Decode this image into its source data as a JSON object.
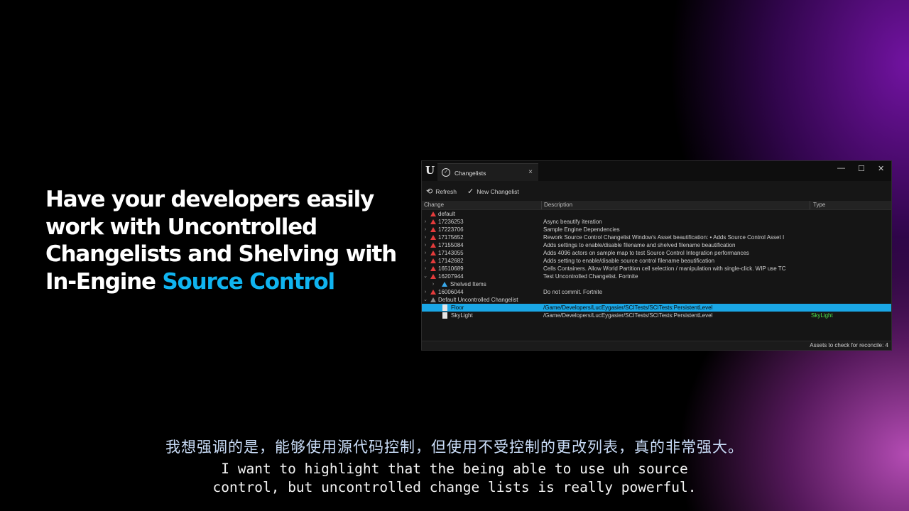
{
  "headline": {
    "text_before": "Have your developers easily work with Uncontrolled Changelists and Shelving with In-Engine ",
    "accent": "Source Control"
  },
  "window": {
    "logo": "U",
    "tab_label": "Changelists",
    "tab_close": "×",
    "controls": {
      "minimize": "—",
      "maximize": "☐",
      "close": "✕"
    },
    "toolbar": {
      "refresh_label": "Refresh",
      "new_changelist_label": "New Changelist"
    },
    "columns": {
      "change": "Change",
      "description": "Description",
      "type": "Type"
    },
    "rows": [
      {
        "change": "default",
        "description": "",
        "type": ""
      },
      {
        "change": "17236253",
        "description": "Async beautify iteration",
        "type": ""
      },
      {
        "change": "17223706",
        "description": "Sample Engine Dependencies",
        "type": ""
      },
      {
        "change": "17175652",
        "description": "Rework Source Control Changelist Window's Asset beautification: • Adds Source Control Asset I",
        "type": ""
      },
      {
        "change": "17155084",
        "description": "Adds settings to enable/disable filename and shelved filename beautification",
        "type": ""
      },
      {
        "change": "17143055",
        "description": "Adds 4096 actors on sample map to test Source Control Integration performances",
        "type": ""
      },
      {
        "change": "17142682",
        "description": "Adds setting to enable/disable source control filename beautification",
        "type": ""
      },
      {
        "change": "16510689",
        "description": "Cells Containers. Allow World Partition cell selection / manipulation with single-click. WIP use TC",
        "type": ""
      },
      {
        "change": "16207944",
        "description": "Test Uncontrolled Changelist. Fortnite",
        "type": ""
      },
      {
        "change": "Shelved Items",
        "description": "",
        "type": ""
      },
      {
        "change": "16006044",
        "description": "Do not commit. Fortnite",
        "type": ""
      },
      {
        "change": "Default Uncontrolled Changelist",
        "description": "",
        "type": ""
      },
      {
        "change": "Floor",
        "description": "/Game/Developers/LucEygasier/SCITests/SCITests:PersistentLevel",
        "type": ""
      },
      {
        "change": "SkyLight",
        "description": "/Game/Developers/LucEygasier/SCITests/SCITests:PersistentLevel",
        "type": "SkyLight"
      }
    ],
    "status": "Assets to check for reconcile: 4"
  },
  "subtitles": {
    "zh": "我想强调的是，能够使用源代码控制，但使用不受控制的更改列表，真的非常强大。",
    "en_line1": "I want to highlight that the being able to use uh source",
    "en_line2": "control, but uncontrolled change lists is really powerful."
  },
  "colors": {
    "accent": "#10b4f0",
    "selection": "#1aa7e6",
    "type_text": "#4ce04c",
    "changelist_icon": "#e43b3b"
  }
}
